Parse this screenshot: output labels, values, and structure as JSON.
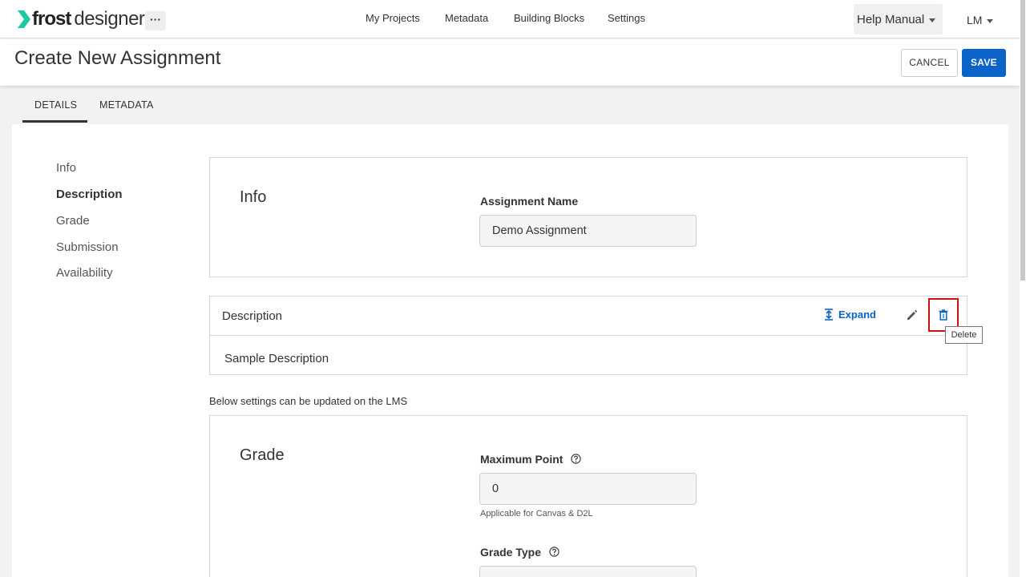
{
  "app": {
    "logo_word1": "frost",
    "logo_word2": "designer",
    "more_label": "···",
    "nav": [
      "My Projects",
      "Metadata",
      "Building Blocks",
      "Settings"
    ],
    "help_label": "Help Manual",
    "user_initials": "LM"
  },
  "header": {
    "title": "Create New Assignment",
    "cancel_label": "CANCEL",
    "save_label": "SAVE"
  },
  "tabs": [
    {
      "label": "DETAILS",
      "active": true
    },
    {
      "label": "METADATA",
      "active": false
    }
  ],
  "sidebar": {
    "items": [
      {
        "label": "Info",
        "active": false
      },
      {
        "label": "Description",
        "active": true
      },
      {
        "label": "Grade",
        "active": false
      },
      {
        "label": "Submission",
        "active": false
      },
      {
        "label": "Availability",
        "active": false
      }
    ]
  },
  "info_section": {
    "title": "Info",
    "assignment_name_label": "Assignment Name",
    "assignment_name_value": "Demo Assignment"
  },
  "description_section": {
    "label": "Description",
    "expand_label": "Expand",
    "delete_tooltip": "Delete",
    "text": "Sample Description"
  },
  "lms_note": "Below settings can be updated on the LMS",
  "grade_section": {
    "title": "Grade",
    "max_point_label": "Maximum Point",
    "max_point_value": "0",
    "max_point_hint": "Applicable for Canvas & D2L",
    "grade_type_label": "Grade Type",
    "grade_type_value": ""
  },
  "colors": {
    "accent": "#0b63c7",
    "logo_green": "#1fc8a0",
    "highlight": "#cc1111"
  }
}
